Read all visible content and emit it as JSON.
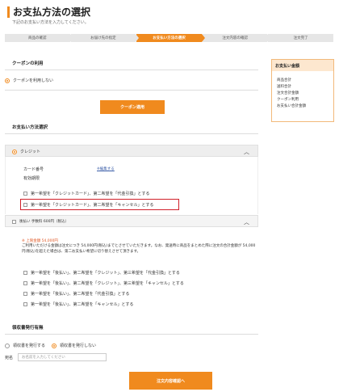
{
  "page": {
    "title": "お支払方法の選択",
    "subtitle": "下記のお支払い方法を入力してください。"
  },
  "steps": [
    "商品の確認",
    "お届け先の指定",
    "お支払い方法の選択",
    "注文内容の確認",
    "注文完了"
  ],
  "coupon": {
    "section_title": "クーポンの利用",
    "option_no": "クーポンを利用しない",
    "apply_button": "クーポン適用"
  },
  "payment": {
    "section_title": "お支払い方法選択",
    "credit_label": "クレジット",
    "card_number_label": "カード番号",
    "card_number_value": "※編集する",
    "expiry_label": "有効期限",
    "credit_options": [
      "第一希望を「クレジットカード」、第二希望を「代金引換」とする",
      "第一希望を「クレジットカード」、第二希望を「キャンセル」とする"
    ],
    "deferred_label": "後払い 手数料 600円（税込）",
    "deferred_limit": "※ 上限金額 54,000円",
    "deferred_notice": "ご利用いただける金額は注文につき 54,000円(税込)までとさせていただきます。なお、発送時に商品をまとめた際に注文の合計金額が 54,000円(税込)を超えた場合は、第二お支払い希望に切り替えさせて頂きます。",
    "deferred_options": [
      "第一希望を「後払い」、第二希望を「クレジット」、第三希望を「代金引換」とする",
      "第一希望を「後払い」、第二希望を「クレジット」、第三希望を「キャンセル」とする",
      "第一希望を「後払い」、第二希望を「代金引換」とする",
      "第一希望を「後払い」、第二希望を「キャンセル」とする"
    ]
  },
  "receipt": {
    "section_title": "領収書発行有無",
    "option_issue": "領収書を発行する",
    "option_no_issue": "領収書を発行しない",
    "name_label": "宛名",
    "name_placeholder": "お名前を入力してください"
  },
  "confirm_button": "注文内容確認へ",
  "summary": {
    "title": "お支払い金額",
    "items": [
      "商品合計",
      "送料合計",
      "注文合計金額",
      "クーポン利用",
      "お支払い合計金額"
    ]
  },
  "colors": {
    "accent": "#f08a1e",
    "highlight": "#d0202a"
  }
}
